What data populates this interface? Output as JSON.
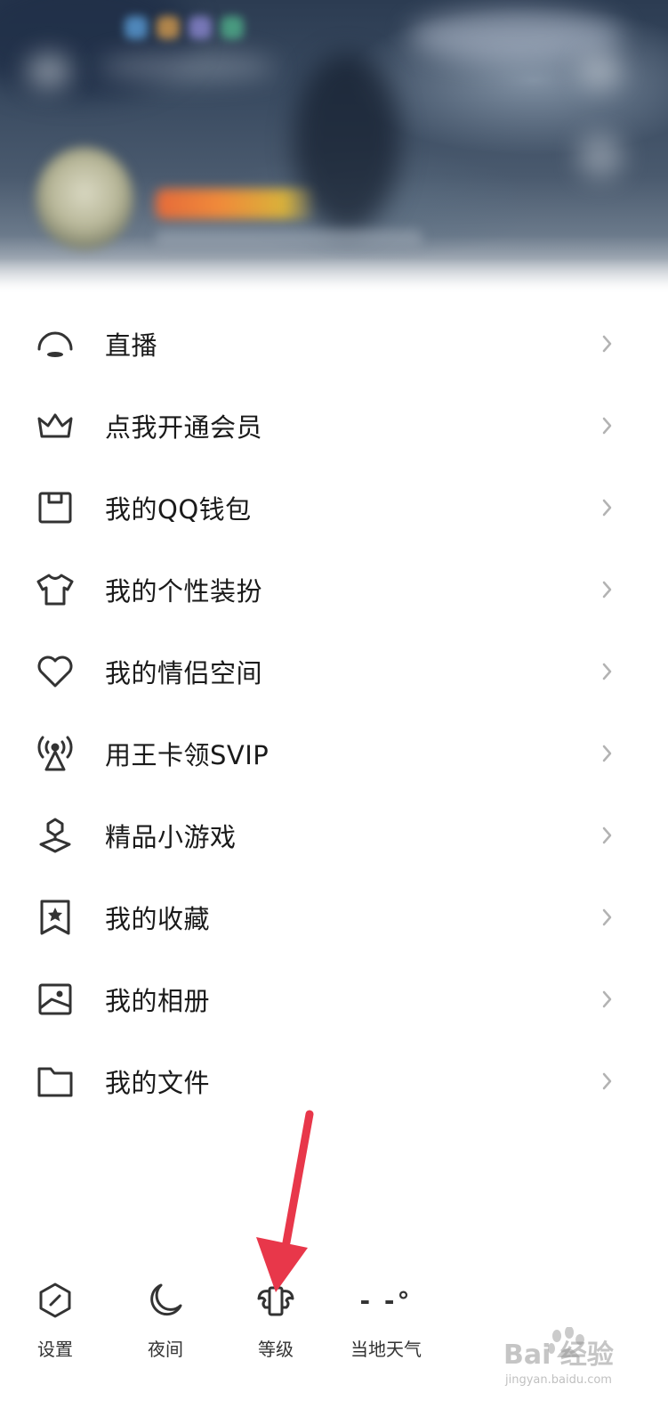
{
  "menu": {
    "items": [
      {
        "label": "直播",
        "icon": "live-icon"
      },
      {
        "label": "点我开通会员",
        "icon": "crown-icon"
      },
      {
        "label": "我的QQ钱包",
        "icon": "wallet-icon"
      },
      {
        "label": "我的个性装扮",
        "icon": "tshirt-icon"
      },
      {
        "label": "我的情侣空间",
        "icon": "heart-icon"
      },
      {
        "label": "用王卡领SVIP",
        "icon": "antenna-icon"
      },
      {
        "label": "精品小游戏",
        "icon": "game-joystick-icon"
      },
      {
        "label": "我的收藏",
        "icon": "bookmark-star-icon"
      },
      {
        "label": "我的相册",
        "icon": "photo-album-icon"
      },
      {
        "label": "我的文件",
        "icon": "folder-icon"
      }
    ]
  },
  "bottom_bar": {
    "settings_label": "设置",
    "night_label": "夜间",
    "level_label": "等级",
    "weather_label": "当地天气",
    "weather_value": "- -°"
  },
  "watermark": {
    "text": "Bai 经验",
    "sub": "jingyan.baidu.com"
  },
  "colors": {
    "annotation_arrow": "#e8374a",
    "icon_stroke": "#333333",
    "chevron": "#b3b3b3"
  }
}
